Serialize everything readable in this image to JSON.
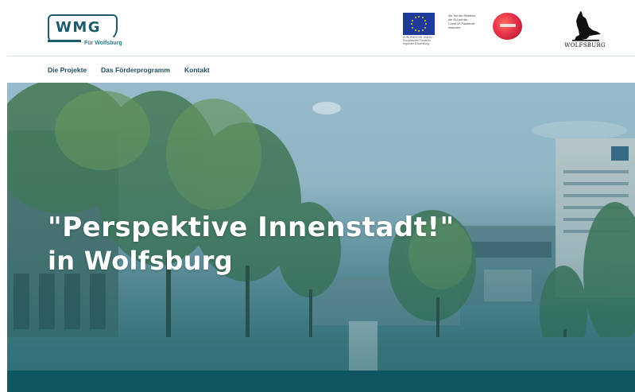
{
  "header": {
    "logo": {
      "title": "WMG",
      "subtitle": "Für Wolfsburg"
    },
    "eu": {
      "caption_lines": [
        "EUROPÄISCHE UNION",
        "Europäischer Fonds für",
        "regionale Entwicklung"
      ]
    },
    "react": {
      "text_lines": [
        "Als Teil der Reaktion",
        "der EU auf die",
        "Covid-19-Pandemie",
        "finanziert"
      ]
    },
    "city": {
      "label": "WOLFSBURG"
    }
  },
  "nav": {
    "items": [
      {
        "label": "Die Projekte"
      },
      {
        "label": "Das Förderprogramm"
      },
      {
        "label": "Kontakt"
      }
    ]
  },
  "hero": {
    "title": "\"Perspektive Innenstadt!\"",
    "subtitle": "in Wolfsburg"
  },
  "colors": {
    "brand": "#1d5a6b",
    "footer": "#0e5560",
    "eu_blue": "#1d3a9a",
    "eu_star": "#ffd400",
    "react_red": "#e8334a"
  },
  "icons": [
    "wmg-logo",
    "eu-flag-icon",
    "react-eu-logo-icon",
    "wolfsburg-wolf-icon"
  ]
}
